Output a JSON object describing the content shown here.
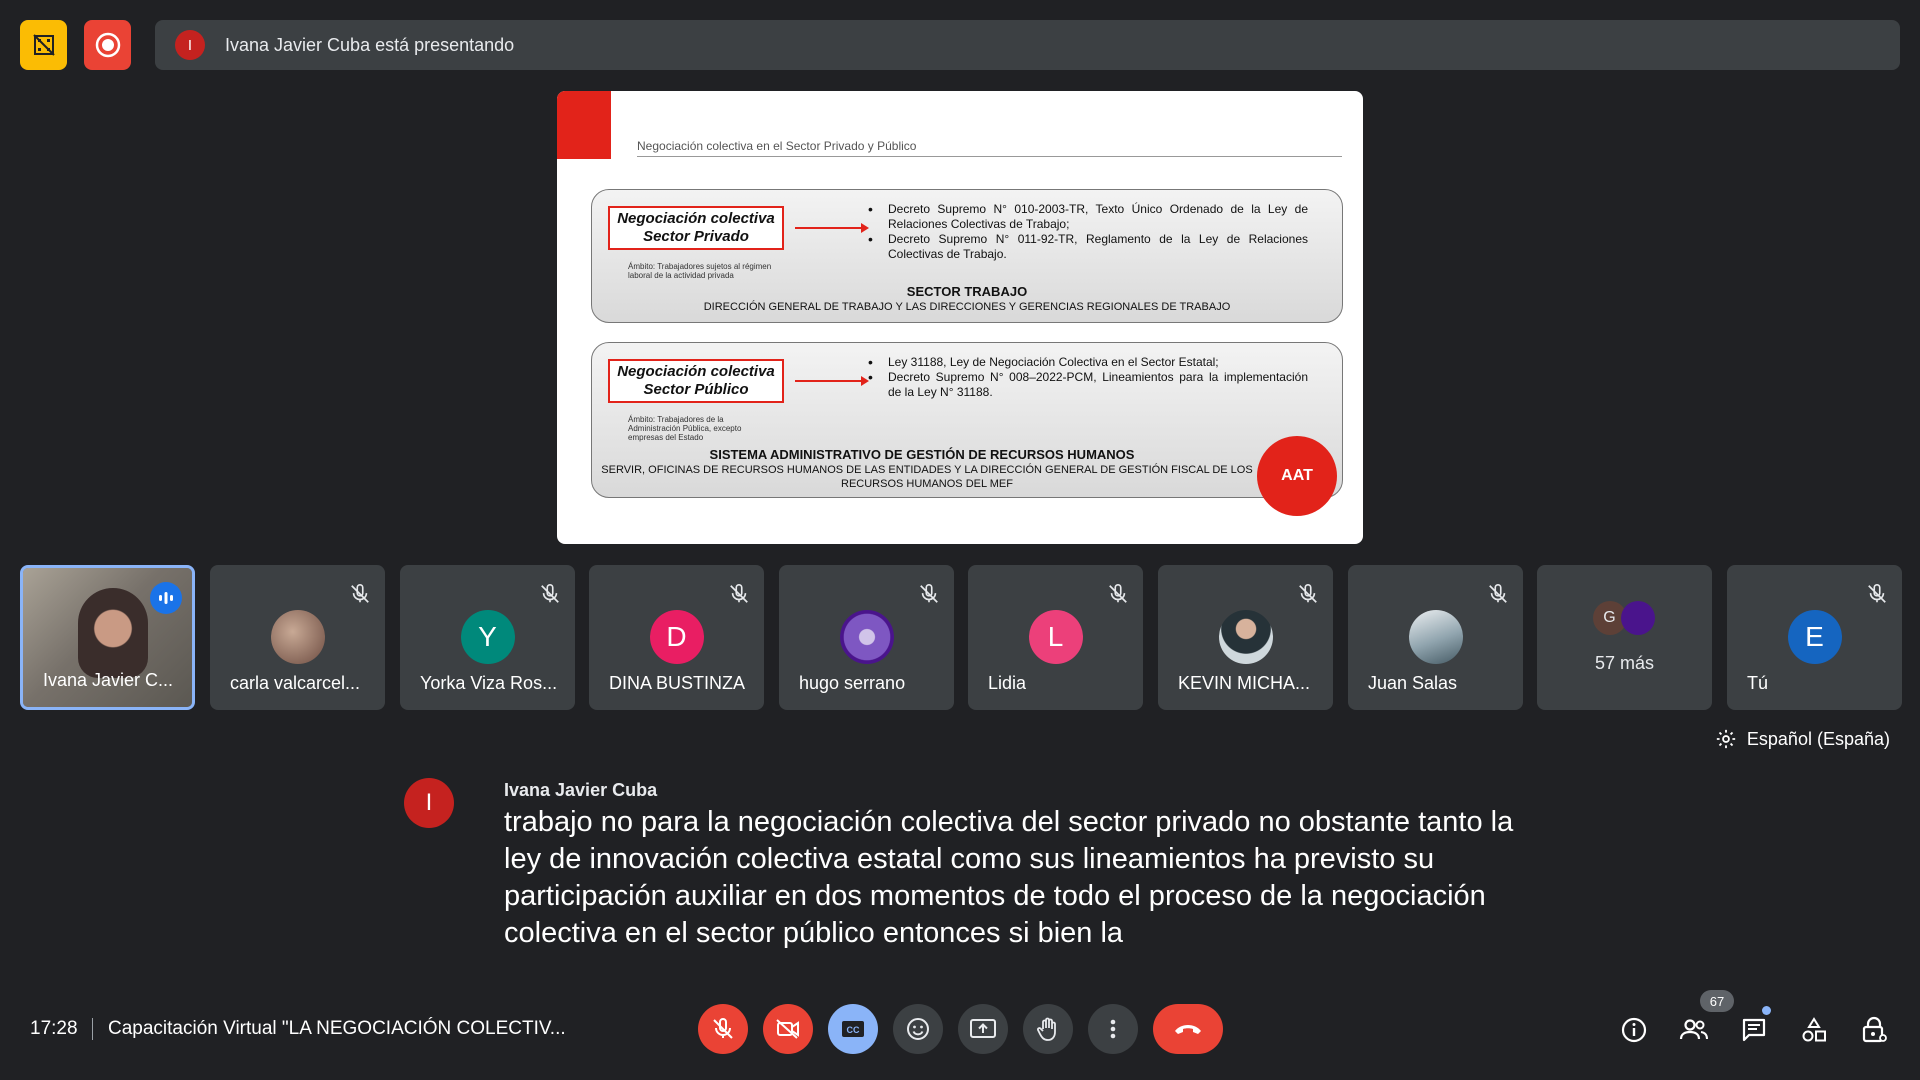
{
  "top_bar": {
    "presenter_initial": "I",
    "presenting_text": "Ivana Javier Cuba está presentando"
  },
  "slide": {
    "header": "Negociación colectiva en el Sector Privado y Público",
    "box1": {
      "tag_line1": "Negociación colectiva",
      "tag_line2": "Sector Privado",
      "ambito": "Ámbito: Trabajadores sujetos al régimen laboral de la actividad privada",
      "bullet1": "Decreto Supremo N° 010-2003-TR, Texto Único Ordenado de la Ley de Relaciones Colectivas de Trabajo;",
      "bullet2": "Decreto Supremo N° 011-92-TR, Reglamento de la Ley de Relaciones Colectivas de Trabajo.",
      "title": "SECTOR TRABAJO",
      "subtitle": "DIRECCIÓN GENERAL DE TRABAJO Y LAS DIRECCIONES Y GERENCIAS REGIONALES DE TRABAJO"
    },
    "box2": {
      "tag_line1": "Negociación colectiva",
      "tag_line2": "Sector Público",
      "ambito": "Ámbito: Trabajadores de la Administración Pública, excepto empresas del Estado",
      "bullet1": "Ley 31188, Ley de Negociación Colectiva en el Sector Estatal;",
      "bullet2": "Decreto Supremo N° 008–2022-PCM, Lineamientos para la implementación de la Ley N° 31188.",
      "title": "SISTEMA ADMINISTRATIVO DE GESTIÓN DE RECURSOS HUMANOS",
      "subtitle": "SERVIR, OFICINAS DE RECURSOS HUMANOS DE LAS ENTIDADES Y LA DIRECCIÓN GENERAL DE GESTIÓN FISCAL DE LOS RECURSOS HUMANOS DEL MEF"
    },
    "logo": "AAT"
  },
  "participants": [
    {
      "name": "Ivana Javier C...",
      "type": "video"
    },
    {
      "name": "carla valcarcel...",
      "type": "photo",
      "color": "#8d6e63"
    },
    {
      "name": "Yorka Viza Ros...",
      "initial": "Y",
      "color": "#00897b"
    },
    {
      "name": "DINA BUSTINZA",
      "initial": "D",
      "color": "#e91e63"
    },
    {
      "name": "hugo serrano",
      "type": "photo",
      "color": "#7e57c2"
    },
    {
      "name": "Lidia",
      "initial": "L",
      "color": "#ec407a"
    },
    {
      "name": "KEVIN MICHA...",
      "type": "photo",
      "color": "#546e7a"
    },
    {
      "name": "Juan Salas",
      "type": "photo",
      "color": "#90a4ae"
    },
    {
      "more": "57 más",
      "initial": "G"
    },
    {
      "name": "Tú",
      "initial": "E",
      "color": "#1565c0"
    }
  ],
  "captions": {
    "language": "Español (España)",
    "speaker_initial": "I",
    "speaker": "Ivana Javier Cuba",
    "text": "trabajo no para la negociación colectiva del sector privado no obstante tanto la ley de innovación colectiva estatal como sus lineamientos ha previsto su participación auxiliar en dos momentos de todo el proceso de la negociación colectiva en el sector público entonces si bien la"
  },
  "bottom_bar": {
    "time": "17:28",
    "meeting_title": "Capacitación Virtual \"LA NEGOCIACIÓN COLECTIV...",
    "participants_count": "67"
  },
  "colors": {
    "background": "#202124",
    "danger": "#ea4335",
    "accent": "#8ab4f8",
    "recording_off": "#fbbc04"
  }
}
